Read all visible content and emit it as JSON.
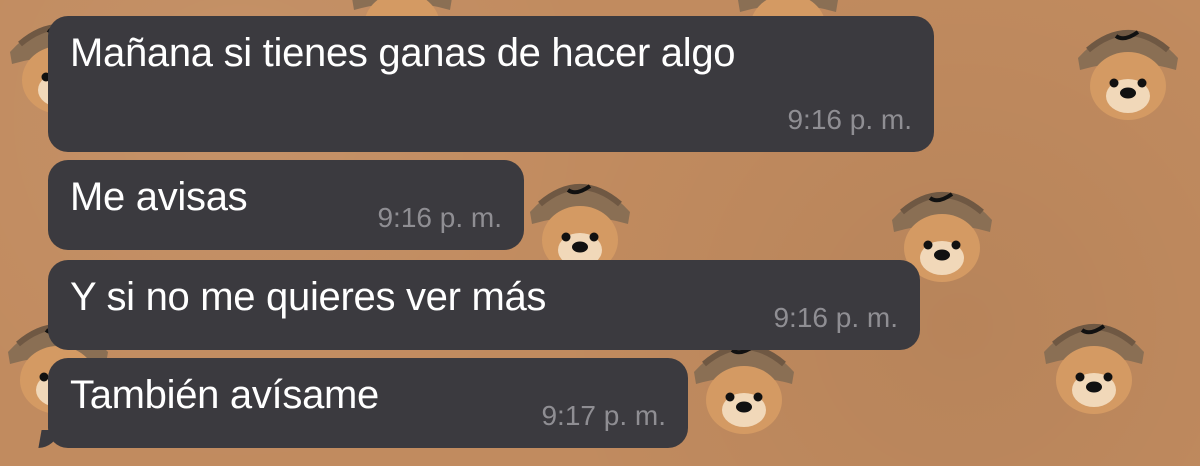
{
  "chat": {
    "background_color": "#c18b5f",
    "sticker_icon": "bucket-hat-dog-icon",
    "messages": [
      {
        "text": "Mañana si tienes ganas de hacer algo",
        "time": "9:16 p. m."
      },
      {
        "text": "Me avisas",
        "time": "9:16 p. m."
      },
      {
        "text": "Y si no me quieres ver más",
        "time": "9:16 p. m."
      },
      {
        "text": "También avísame",
        "time": "9:17 p. m."
      }
    ]
  }
}
